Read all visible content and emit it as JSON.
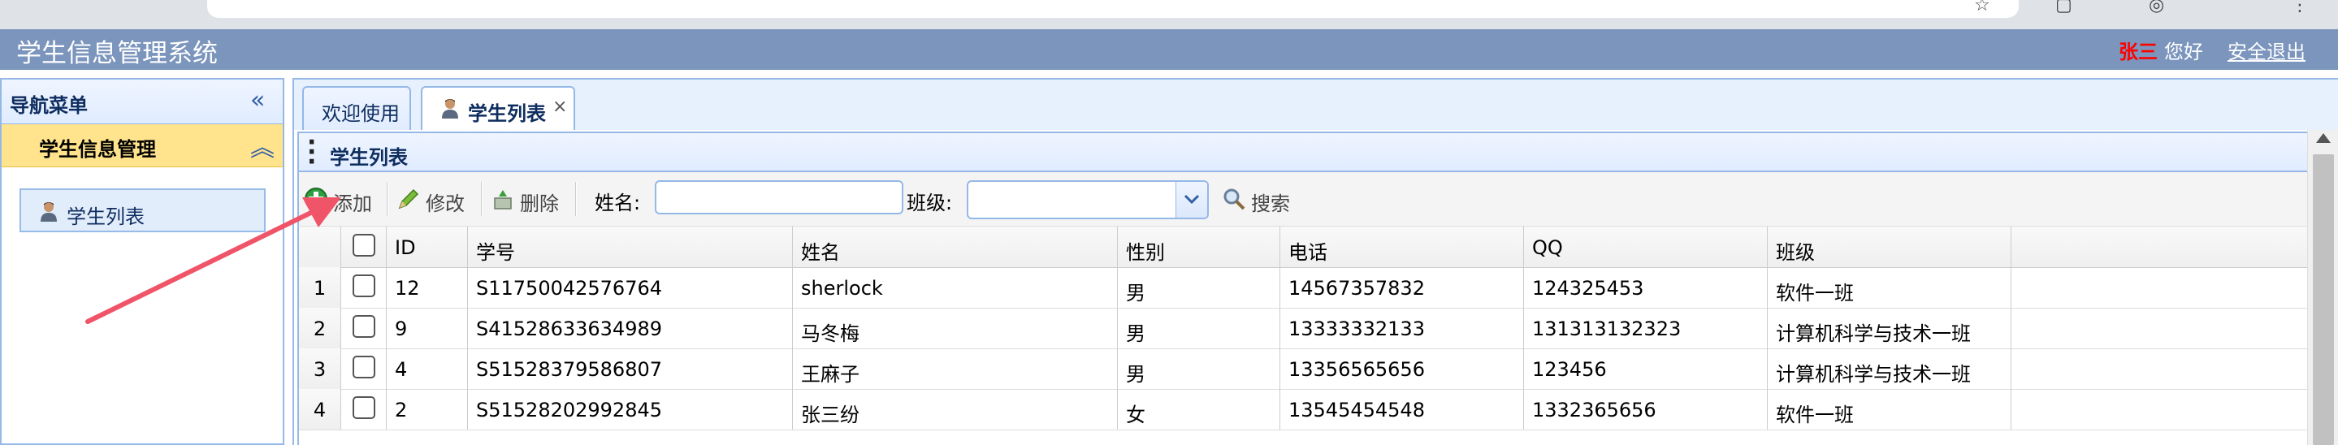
{
  "header": {
    "title": "学生信息管理系统",
    "user_name": "张三",
    "greeting": "您好",
    "logout": "安全退出"
  },
  "nav": {
    "title": "导航菜单",
    "group": "学生信息管理",
    "item": "学生列表"
  },
  "tabs": [
    {
      "label": "欢迎使用"
    },
    {
      "label": "学生列表",
      "close": "×"
    }
  ],
  "panel": {
    "title": "学生列表"
  },
  "toolbar": {
    "add": "添加",
    "edit": "修改",
    "delete": "删除",
    "name_label": "姓名:",
    "name_value": "",
    "class_label": "班级:",
    "class_value": "",
    "search": "搜索"
  },
  "grid": {
    "columns": [
      "ID",
      "学号",
      "姓名",
      "性别",
      "电话",
      "QQ",
      "班级"
    ],
    "rows": [
      {
        "n": "1",
        "id": "12",
        "sno": "S11750042576764",
        "name": "sherlock",
        "sex": "男",
        "phone": "14567357832",
        "qq": "124325453",
        "cls": "软件一班"
      },
      {
        "n": "2",
        "id": "9",
        "sno": "S41528633634989",
        "name": "马冬梅",
        "sex": "男",
        "phone": "13333332133",
        "qq": "131313132323",
        "cls": "计算机科学与技术一班"
      },
      {
        "n": "3",
        "id": "4",
        "sno": "S51528379586807",
        "name": "王麻子",
        "sex": "男",
        "phone": "13356565656",
        "qq": "123456",
        "cls": "计算机科学与技术一班"
      },
      {
        "n": "4",
        "id": "2",
        "sno": "S51528202992845",
        "name": "张三纷",
        "sex": "女",
        "phone": "13545454548",
        "qq": "1332365656",
        "cls": "软件一班"
      }
    ]
  },
  "colors": {
    "header_bg": "#7b95bd",
    "user_name": "#ff0000",
    "nav_group_bg": "#ffe48d",
    "border": "#95b8e7",
    "annotation_arrow": "#f05468"
  }
}
